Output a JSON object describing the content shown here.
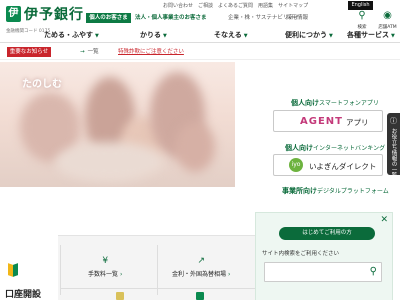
{
  "header": {
    "logo_mark": "伊",
    "bank_name": "伊予銀行",
    "bank_code": "金融機関コード 0175",
    "util_links": [
      "お問い合わせ",
      "ご相談",
      "よくあるご質問",
      "用語集",
      "サイトマップ"
    ],
    "english_label": "English",
    "audience_tabs": {
      "personal": "個人のお客さま",
      "business": "法人・個人事業主のお客さま",
      "corporate": "企業・株・サステナビリティ",
      "recruit": "採用情報"
    },
    "search_label": "検索",
    "store_label": "店舗ATM"
  },
  "main_nav": [
    "ためる・ふやす",
    "かりる",
    "そなえる",
    "便利につかう",
    "各種サービス"
  ],
  "notice": {
    "important_label": "重要なお知らせ",
    "list_label": "一覧",
    "message": "特殊詐欺にご注意ください"
  },
  "hero": {
    "caption": "たのしむ"
  },
  "apps": {
    "agent_heading_strong": "個人向け",
    "agent_heading_rest": "スマートフォンアプリ",
    "agent_logo": "AGENT",
    "agent_word": "アプリ",
    "direct_heading_strong": "個人向け",
    "direct_heading_rest": "インターネットバンキング",
    "direct_mark": "iyo",
    "direct_word": "いよぎんダイレクト",
    "business_heading_strong": "事業所向け",
    "business_heading_rest": "デジタルプラットフォーム"
  },
  "side_tab": {
    "text": "お役立ち情報の一覧"
  },
  "chat": {
    "pill": "はじめてご利用の方",
    "search_label": "サイト内検索をご利用ください",
    "close_icon": "close-icon"
  },
  "bottom": {
    "account_label": "口座開設",
    "grid": [
      "手数料一覧",
      "金利・外国為替相場"
    ]
  },
  "colors": {
    "brand_green": "#0b6b3b",
    "alert_red": "#c9252c"
  }
}
